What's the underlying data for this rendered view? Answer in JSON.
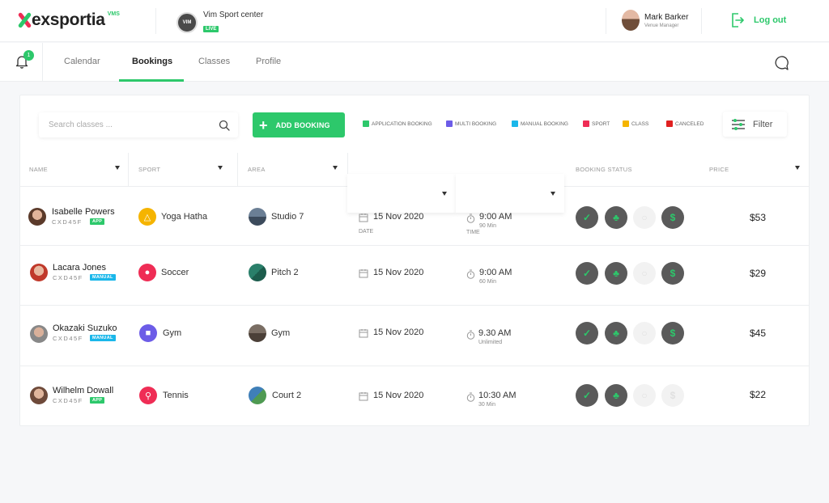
{
  "header": {
    "logo_text": "exsportia",
    "logo_suffix": "VMS",
    "venue_name": "Vim Sport center",
    "venue_status": "LIVE",
    "venue_logo_text": "VIM",
    "user_name": "Mark Barker",
    "user_role": "Venue Manager",
    "logout_label": "Log out"
  },
  "nav": {
    "notification_count": "1",
    "tabs": [
      {
        "label": "Calendar"
      },
      {
        "label": "Bookings"
      },
      {
        "label": "Classes"
      },
      {
        "label": "Profile"
      }
    ],
    "active_tab": "Bookings"
  },
  "toolbar": {
    "search_placeholder": "Search classes ...",
    "add_label": "ADD BOOKING",
    "filter_label": "Filter",
    "legend": [
      {
        "label": "APPLICATION BOOKING",
        "color": "#2dc86b"
      },
      {
        "label": "MULTI BOOKING",
        "color": "#6c5ce7"
      },
      {
        "label": "MANUAL BOOKING",
        "color": "#1ab7ea"
      },
      {
        "label": "SPORT",
        "color": "#ef2d55"
      },
      {
        "label": "CLASS",
        "color": "#f5b400"
      },
      {
        "label": "CANCELED",
        "color": "#e02020"
      }
    ]
  },
  "table": {
    "columns": {
      "name": "NAME",
      "sport": "SPORT",
      "area": "AREA",
      "status": "BOOKING STATUS",
      "price": "PRICE",
      "date_sub": "DATE",
      "time_sub": "TIME"
    },
    "rows": [
      {
        "name": "Isabelle Powers",
        "code": "CXD45F",
        "badge": "APP",
        "sport": "Yoga Hatha",
        "area": "Studio 7",
        "date": "15 Nov 2020",
        "time": "9:00 AM",
        "duration": "90 Min",
        "price": "$53"
      },
      {
        "name": "Lacara Jones",
        "code": "CXD45F",
        "badge": "MANUAL",
        "sport": "Soccer",
        "area": "Pitch 2",
        "date": "15 Nov 2020",
        "time": "9:00 AM",
        "duration": "60 Min",
        "price": "$29"
      },
      {
        "name": "Okazaki Suzuko",
        "code": "CXD45F",
        "badge": "MANUAL",
        "sport": "Gym",
        "area": "Gym",
        "date": "15 Nov 2020",
        "time": "9.30 AM",
        "duration": "Unlimited",
        "price": "$45"
      },
      {
        "name": "Wilhelm Dowall",
        "code": "CXD45F",
        "badge": "APP",
        "sport": "Tennis",
        "area": "Court 2",
        "date": "15 Nov 2020",
        "time": "10:30 AM",
        "duration": "30 Min",
        "price": "$22"
      }
    ]
  },
  "colors": {
    "accent": "#2dc86b",
    "status_icon": "#2dc86b",
    "status_dark": "#5a5a5a",
    "status_light": "#f2f2f2"
  }
}
